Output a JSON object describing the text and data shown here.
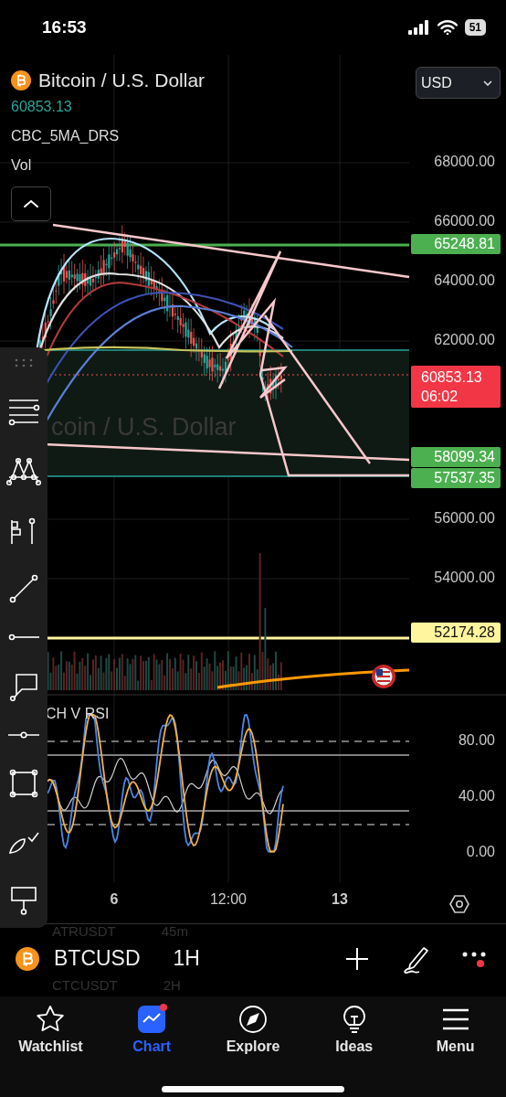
{
  "status_bar": {
    "time": "16:53",
    "battery": "51"
  },
  "symbol_header": {
    "title": "Bitcoin / U.S. Dollar",
    "last_price": "60853.13",
    "currency": "USD"
  },
  "indicators": [
    {
      "name": "CBC_5MA_DRS"
    },
    {
      "name": "Vol"
    }
  ],
  "watermark": [
    "coin / U.S. Dollar"
  ],
  "price_axis": [
    "68000.00",
    "66000.00",
    "64000.00",
    "62000.00",
    "56000.00",
    "54000.00"
  ],
  "price_badges": [
    {
      "text": "65248.81",
      "color": "#4caf50"
    },
    {
      "text": "58099.34",
      "color": "#4caf50"
    },
    {
      "text": "57537.35",
      "color": "#4caf50"
    },
    {
      "text": "52174.28",
      "color": "#fff59d"
    }
  ],
  "current_price": {
    "price": "60853.13",
    "countdown": "06:02"
  },
  "oscillator": {
    "name": "CH V RSI",
    "axis": [
      "80.00",
      "40.00",
      "0.00"
    ]
  },
  "time_axis": [
    {
      "label": "6",
      "kind": "day"
    },
    {
      "label": "12:00",
      "kind": "time"
    },
    {
      "label": "13",
      "kind": "day"
    }
  ],
  "background_list": [
    {
      "symbol": "ATRUSDT",
      "interval": "45m"
    },
    {
      "symbol": "CTCUSDT",
      "interval": "2H"
    }
  ],
  "symbol_bar": {
    "symbol": "BTCUSD",
    "interval": "1H",
    "more_badge": true
  },
  "tabs": [
    {
      "label": "Watchlist",
      "selected": false,
      "badge": false
    },
    {
      "label": "Chart",
      "selected": true,
      "badge": true
    },
    {
      "label": "Explore",
      "selected": false,
      "badge": false
    },
    {
      "label": "Ideas",
      "selected": false,
      "badge": false
    },
    {
      "label": "Menu",
      "selected": false,
      "badge": false
    }
  ]
}
